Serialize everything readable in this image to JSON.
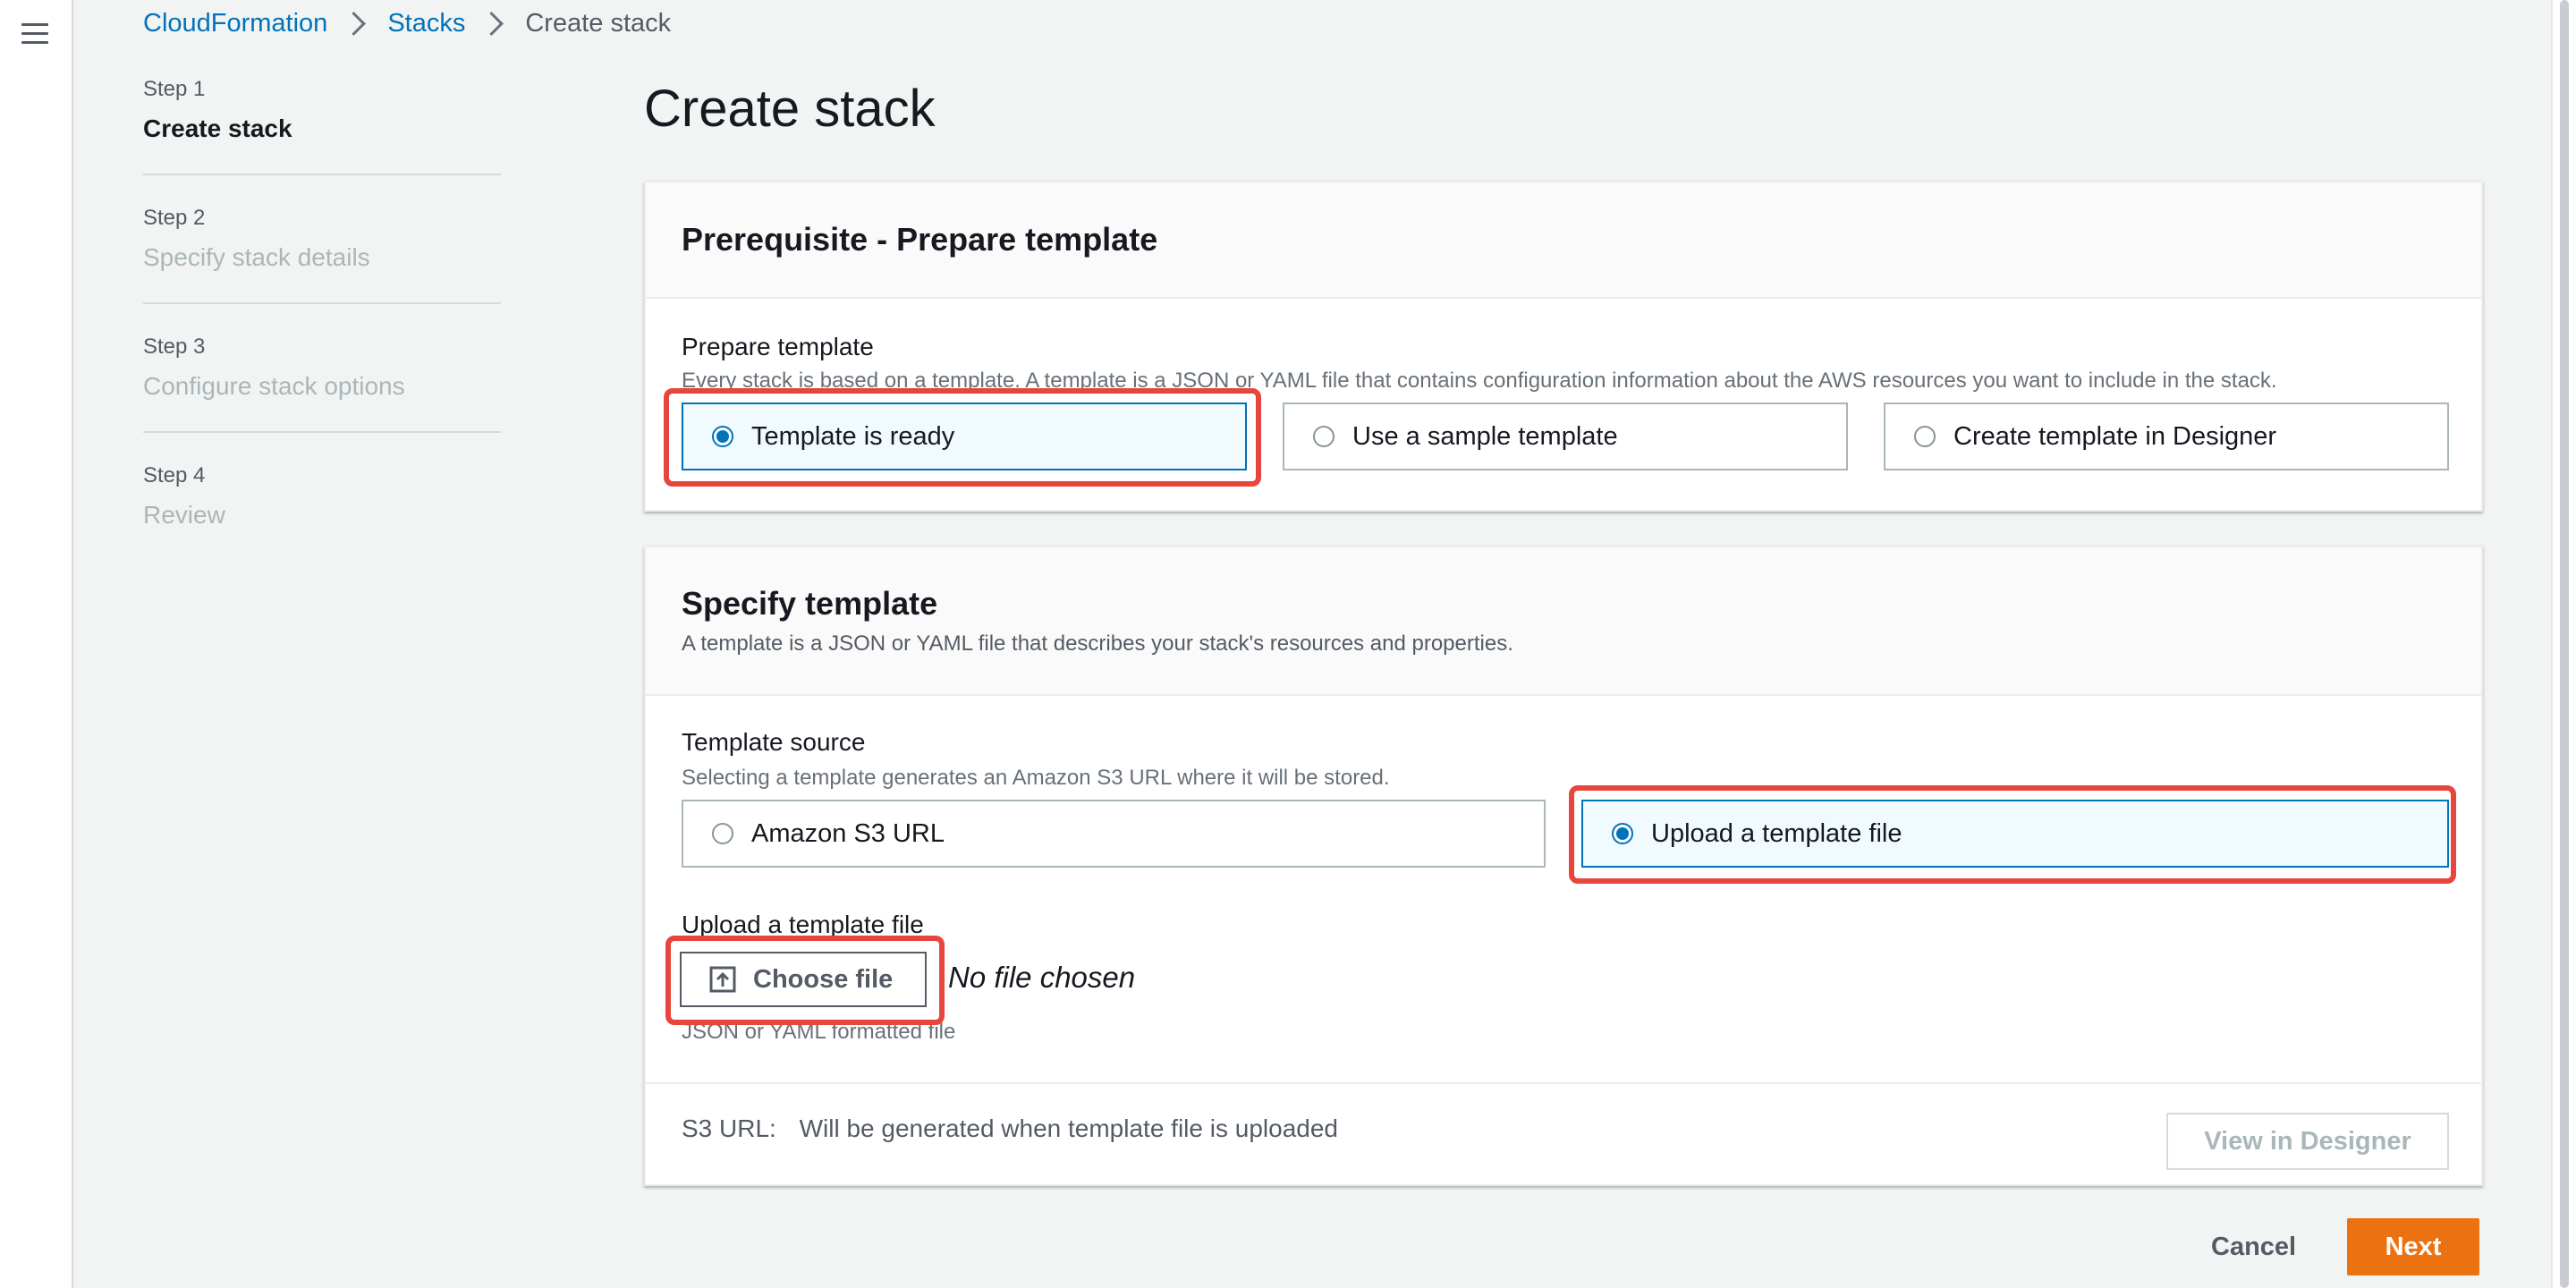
{
  "breadcrumb": {
    "items": [
      "CloudFormation",
      "Stacks"
    ],
    "current": "Create stack"
  },
  "steps": [
    {
      "num": "Step 1",
      "title": "Create stack"
    },
    {
      "num": "Step 2",
      "title": "Specify stack details"
    },
    {
      "num": "Step 3",
      "title": "Configure stack options"
    },
    {
      "num": "Step 4",
      "title": "Review"
    }
  ],
  "page_title": "Create stack",
  "prerequisite": {
    "heading": "Prerequisite - Prepare template",
    "label": "Prepare template",
    "description": "Every stack is based on a template. A template is a JSON or YAML file that contains configuration information about the AWS resources you want to include in the stack.",
    "options": [
      "Template is ready",
      "Use a sample template",
      "Create template in Designer"
    ],
    "selected": "Template is ready"
  },
  "specify": {
    "heading": "Specify template",
    "description": "A template is a JSON or YAML file that describes your stack's resources and properties.",
    "source_label": "Template source",
    "source_description": "Selecting a template generates an Amazon S3 URL where it will be stored.",
    "source_options": [
      "Amazon S3 URL",
      "Upload a template file"
    ],
    "source_selected": "Upload a template file",
    "upload_label": "Upload a template file",
    "choose_file": "Choose file",
    "no_file": "No file chosen",
    "file_hint": "JSON or YAML formatted file",
    "s3_label": "S3 URL:",
    "s3_value": "Will be generated when template file is uploaded",
    "view_designer": "View in Designer"
  },
  "footer": {
    "cancel": "Cancel",
    "next": "Next"
  },
  "colors": {
    "accent": "#0073bb",
    "primary_button": "#ec7211",
    "highlight": "#e8453c"
  }
}
